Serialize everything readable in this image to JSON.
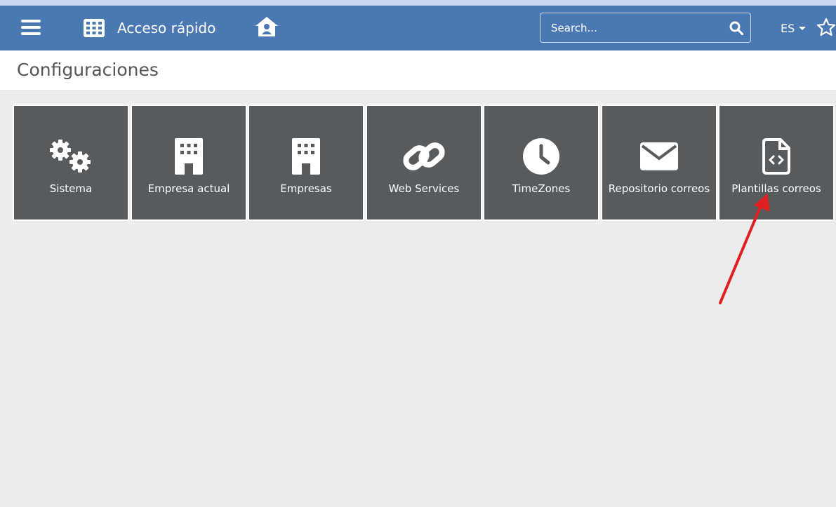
{
  "navbar": {
    "quick_access_label": "Acceso rápido",
    "search_placeholder": "Search...",
    "language": "ES",
    "icons": [
      "menu-icon",
      "grid-icon",
      "home-user-icon",
      "search-icon",
      "caret-down-icon",
      "star-icon"
    ]
  },
  "page": {
    "title": "Configuraciones"
  },
  "tiles": [
    {
      "label": "Sistema",
      "icon": "gears-icon"
    },
    {
      "label": "Empresa actual",
      "icon": "building-icon"
    },
    {
      "label": "Empresas",
      "icon": "building-icon"
    },
    {
      "label": "Web Services",
      "icon": "link-icon"
    },
    {
      "label": "TimeZones",
      "icon": "clock-icon"
    },
    {
      "label": "Repositorio correos",
      "icon": "envelope-icon"
    },
    {
      "label": "Plantillas correos",
      "icon": "file-code-icon"
    }
  ],
  "colors": {
    "navbar": "#4a78b3",
    "tile": "#585b5e",
    "background": "#ececec",
    "arrow": "#e02020"
  }
}
